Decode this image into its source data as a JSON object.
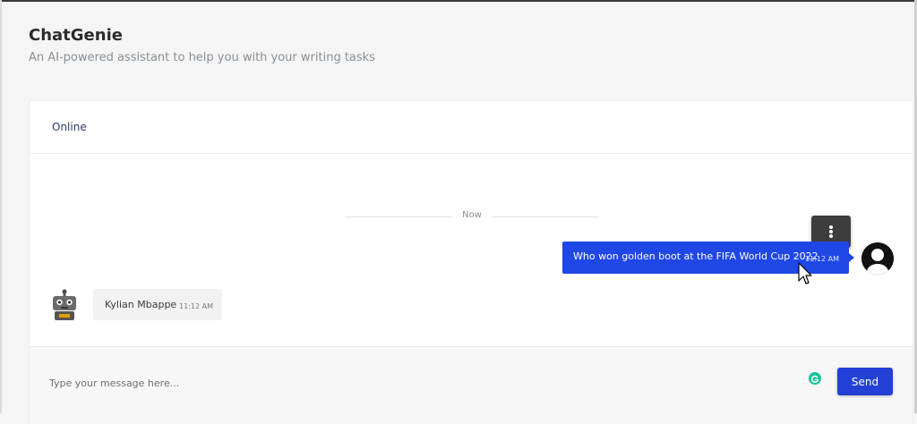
{
  "app": {
    "title": "ChatGenie",
    "subtitle": "An AI-powered assistant to help you with your writing tasks"
  },
  "chat": {
    "status": "Online",
    "separator_label": "Now",
    "messages": [
      {
        "sender": "user",
        "text": "Who won golden boot at the FIFA World Cup 2022",
        "time": "11:12 AM"
      },
      {
        "sender": "bot",
        "text": "Kylian Mbappe",
        "time": "11:12 AM"
      }
    ]
  },
  "composer": {
    "placeholder": "Type your message here...",
    "value": "",
    "send_label": "Send"
  },
  "icons": {
    "message_menu": "more-vertical-icon",
    "user_avatar": "user-avatar-icon",
    "bot_avatar": "robot-icon",
    "grammar": "grammarly-icon",
    "cursor": "mouse-cursor-icon"
  },
  "colors": {
    "accent": "#2340d6",
    "user_bubble": "#1f47e6",
    "bot_bubble": "#f1f2f1",
    "status_text": "#2b3a6e"
  }
}
